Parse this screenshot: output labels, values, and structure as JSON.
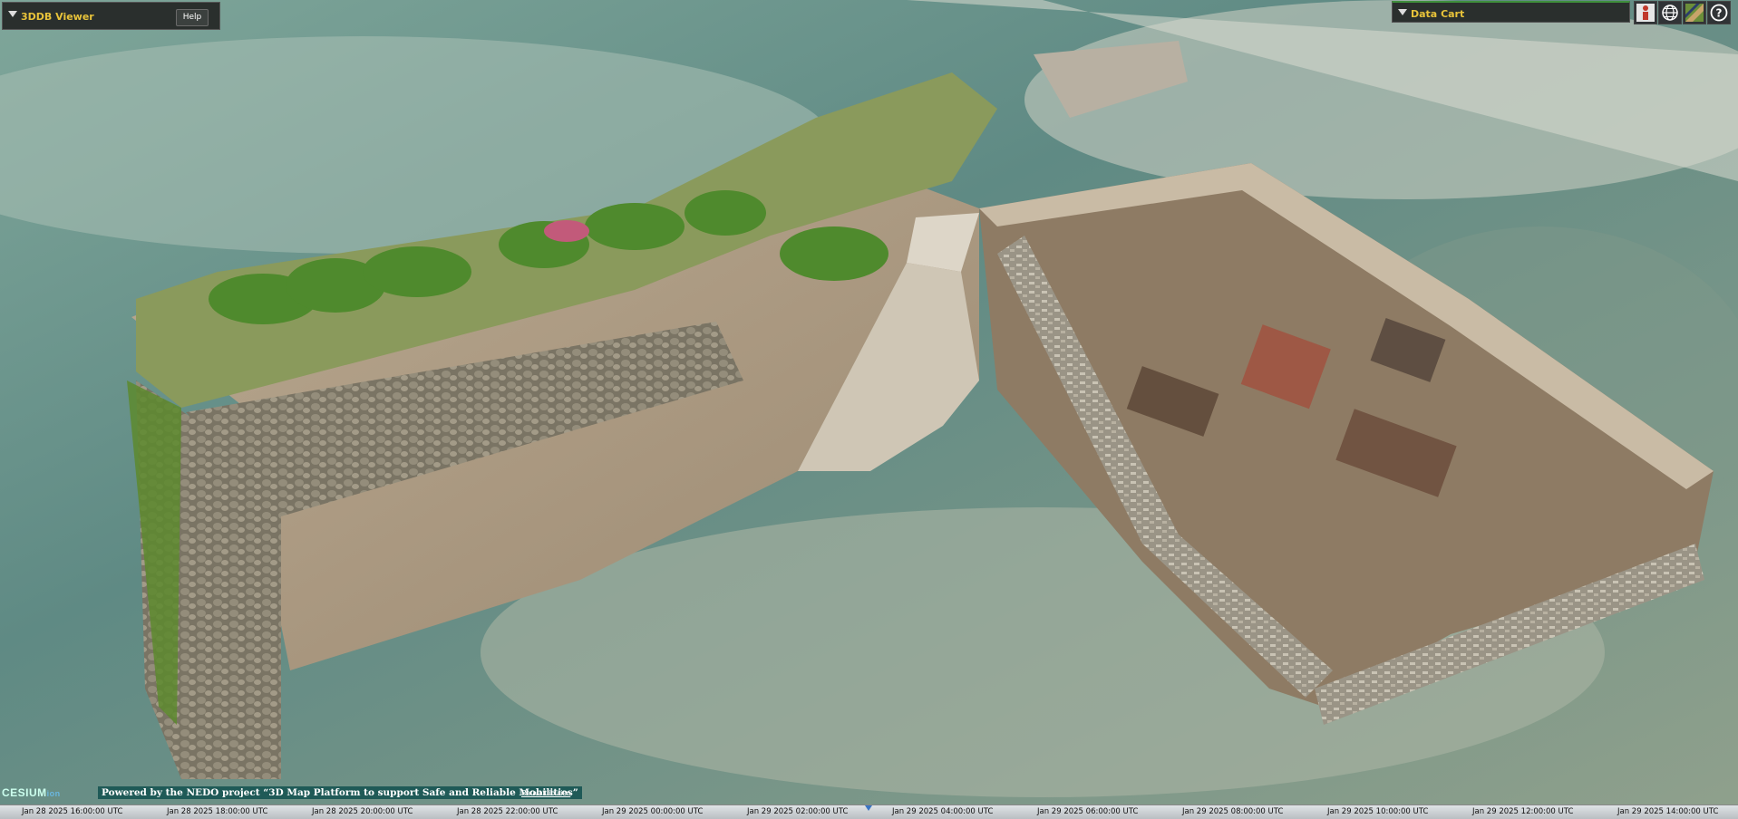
{
  "viewer_panel": {
    "title": "3DDB Viewer",
    "help_label": "Help"
  },
  "data_cart": {
    "title": "Data Cart"
  },
  "toolbar": {
    "icons": [
      "person-icon",
      "globe-icon",
      "layers-icon",
      "help-icon"
    ],
    "help_glyph": "?"
  },
  "credits": {
    "logo": "CESIUM",
    "logo_sub": "ion",
    "nedo": "Powered by the NEDO project “3D Map Platform to support Safe and Reliable Mobilities”",
    "attribution": "Data attribution"
  },
  "timeline": {
    "ticks": [
      "Jan 28 2025 16:00:00 UTC",
      "Jan 28 2025 18:00:00 UTC",
      "Jan 28 2025 20:00:00 UTC",
      "Jan 28 2025 22:00:00 UTC",
      "Jan 29 2025 00:00:00 UTC",
      "Jan 29 2025 02:00:00 UTC",
      "Jan 29 2025 04:00:00 UTC",
      "Jan 29 2025 06:00:00 UTC",
      "Jan 29 2025 08:00:00 UTC",
      "Jan 29 2025 10:00:00 UTC",
      "Jan 29 2025 12:00:00 UTC",
      "Jan 29 2025 14:00:00 UTC"
    ]
  },
  "colors": {
    "accent": "#e8c33a",
    "panel": "#2a2f2d",
    "credit_bg": "#1f5a57"
  }
}
